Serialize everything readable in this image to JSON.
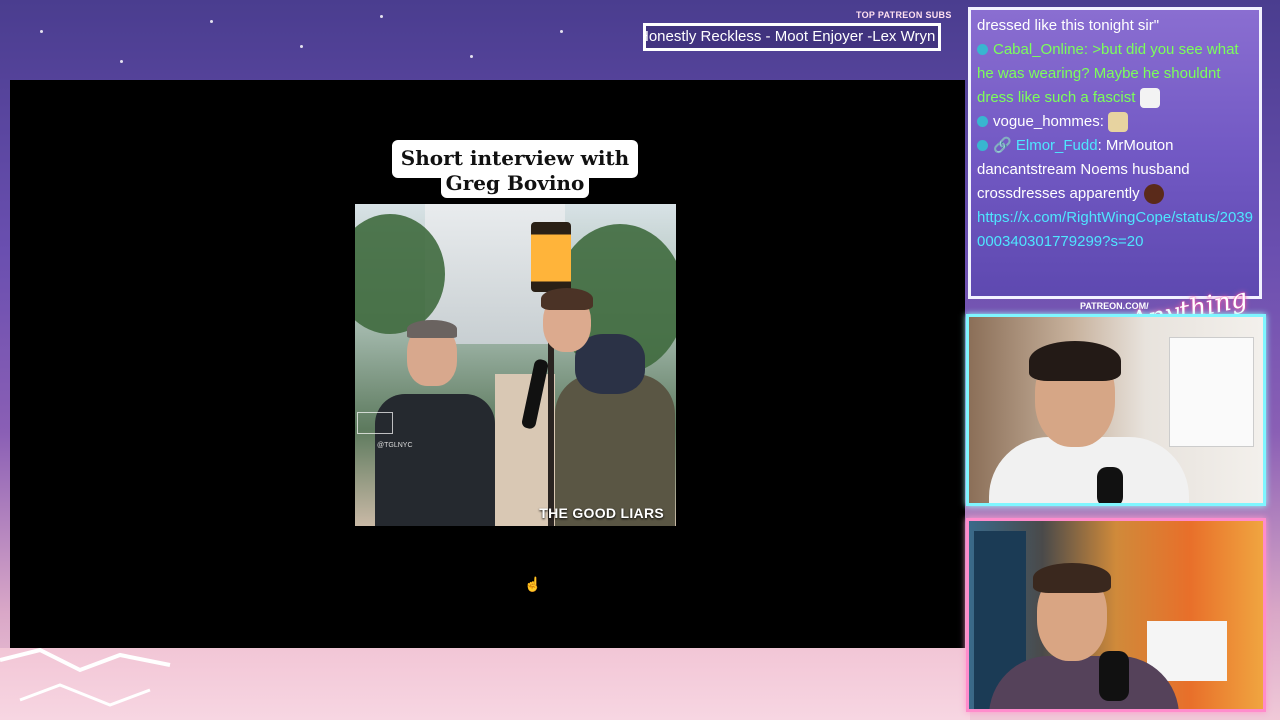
{
  "overlay": {
    "patreon_header": "TOP PATREON SUBS",
    "patreon_marquee": "Honestly Reckless - Moot Enjoyer -Lex Wryn",
    "brand_url": "PATREON.COM/",
    "brand_logo": "Anything Else?"
  },
  "video": {
    "title_line1": "Short interview with",
    "title_line2": "Greg Bovino",
    "watermark": "THE GOOD LIARS",
    "ig_handle": "@TGLNYC"
  },
  "chat": {
    "messages": [
      {
        "user": "",
        "text": "dressed like this tonight sir\""
      },
      {
        "user": "Cabal_Online",
        "user_color": "#7CFF5A",
        "text": ">but did you see what he was wearing? Maybe he shouldnt dress like such a fascist",
        "text_color": "#7CFF5A"
      },
      {
        "user": "vogue_hommes",
        "user_color": "#ffffff",
        "text": ""
      },
      {
        "user": "Elmor_Fudd",
        "user_color": "#4fe6ff",
        "text": "MrMouton dancantstream Noems husband crossdresses apparently",
        "link": "https://x.com/RightWingCope/status/2039000340301779299?s=20"
      }
    ]
  },
  "colors": {
    "chat_link": "#4fe6ff",
    "cam1_border": "#7ff6ff",
    "cam2_border": "#ff8ccc"
  }
}
